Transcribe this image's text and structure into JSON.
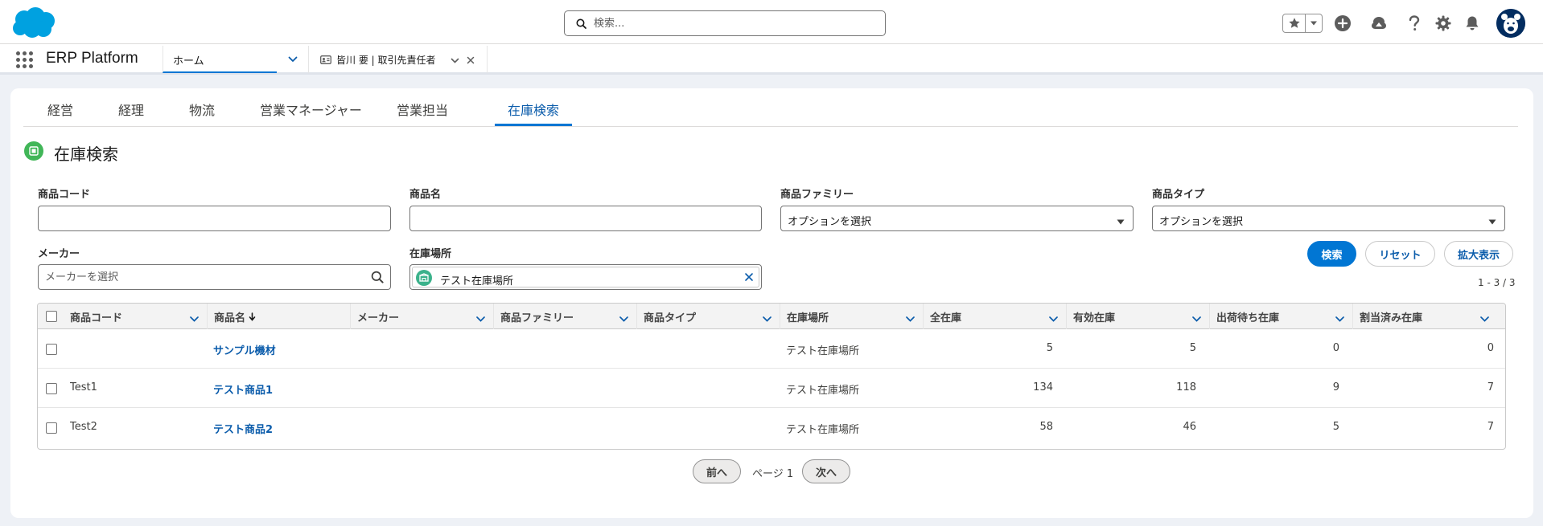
{
  "header": {
    "search_placeholder": "検索...",
    "icons": [
      "salesforce-cloud-icon",
      "search-icon",
      "favorites-star-icon",
      "chevron-down-icon",
      "global-add-icon",
      "trailhead-icon",
      "help-icon",
      "setup-gear-icon",
      "notification-bell-icon",
      "user-avatar-icon"
    ]
  },
  "context_bar": {
    "app_name": "ERP Platform",
    "tabs": [
      {
        "label": "ホーム"
      },
      {
        "label": "皆川 要 | 取引先責任者"
      }
    ]
  },
  "app_tabs": [
    {
      "label": "経営"
    },
    {
      "label": "経理"
    },
    {
      "label": "物流"
    },
    {
      "label": "営業マネージャー"
    },
    {
      "label": "営業担当"
    },
    {
      "label": "在庫検索"
    }
  ],
  "page": {
    "title": "在庫検索"
  },
  "filters": {
    "product_code": {
      "label": "商品コード",
      "value": ""
    },
    "product_name": {
      "label": "商品名",
      "value": ""
    },
    "product_family": {
      "label": "商品ファミリー",
      "value": "オプションを選択"
    },
    "product_type": {
      "label": "商品タイプ",
      "value": "オプションを選択"
    },
    "maker": {
      "label": "メーカー",
      "placeholder": "メーカーを選択"
    },
    "location": {
      "label": "在庫場所",
      "pill": "テスト在庫場所"
    }
  },
  "buttons": {
    "search": "検索",
    "reset": "リセット",
    "expand": "拡大表示"
  },
  "result_count": "1 - 3 / 3",
  "table": {
    "columns": [
      "商品コード",
      "商品名",
      "メーカー",
      "商品ファミリー",
      "商品タイプ",
      "在庫場所",
      "全在庫",
      "有効在庫",
      "出荷待ち在庫",
      "割当済み在庫"
    ],
    "sort_column": "商品名",
    "sort_direction": "descending",
    "rows": [
      {
        "code": "",
        "name": "サンプル機材",
        "maker": "",
        "family": "",
        "type": "",
        "location": "テスト在庫場所",
        "total": "5",
        "available": "5",
        "pending": "0",
        "allocated": "0"
      },
      {
        "code": "Test1",
        "name": "テスト商品1",
        "maker": "",
        "family": "",
        "type": "",
        "location": "テスト在庫場所",
        "total": "134",
        "available": "118",
        "pending": "9",
        "allocated": "7"
      },
      {
        "code": "Test2",
        "name": "テスト商品2",
        "maker": "",
        "family": "",
        "type": "",
        "location": "テスト在庫場所",
        "total": "58",
        "available": "46",
        "pending": "5",
        "allocated": "7"
      }
    ]
  },
  "pagination": {
    "prev": "前へ",
    "page": "ページ 1",
    "next": "次へ"
  },
  "colors": {
    "brand": "#0176d3",
    "link": "#0b5cab",
    "salesforce_cloud": "#00a1e0",
    "page_icon": "#41b658",
    "location_icon": "#3bb28b"
  }
}
